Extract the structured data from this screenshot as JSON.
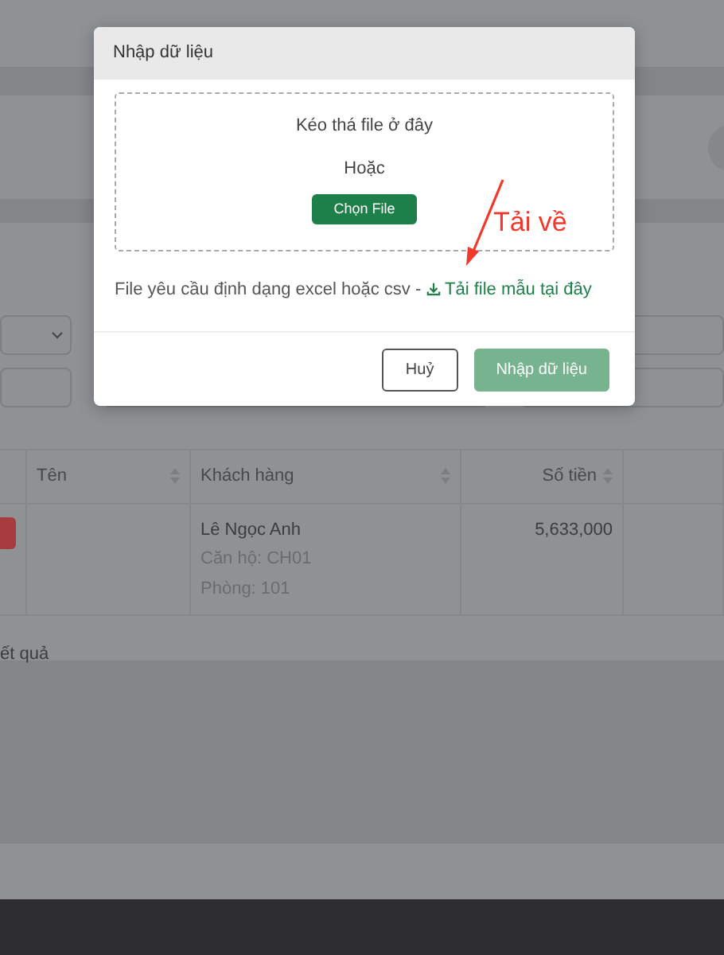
{
  "table": {
    "columns": [
      {
        "label": "Tên",
        "sortable": true
      },
      {
        "label": "Khách hàng",
        "sortable": true
      },
      {
        "label": "Số tiền",
        "sortable": true
      }
    ],
    "rows": [
      {
        "customer": "Lê Ngọc Anh",
        "apartment": "Căn hộ: CH01",
        "room": "Phòng: 101",
        "amount": "5,633,000"
      }
    ]
  },
  "result_text": "ết quả",
  "dialog": {
    "title": "Nhập dữ liệu",
    "dropzone": {
      "prompt": "Kéo thá file ở đây",
      "separator": "Hoặc",
      "choose_button": "Chọn File"
    },
    "note": "File yêu cầu định dạng excel hoặc csv -",
    "template_link": "Tải file mẫu tại đây",
    "buttons": [
      {
        "label": "Huỷ",
        "kind": "cancel"
      },
      {
        "label": "Nhập dữ liệu",
        "kind": "primary",
        "disabled": true
      }
    ]
  },
  "annotation": {
    "text": "Tải về"
  }
}
